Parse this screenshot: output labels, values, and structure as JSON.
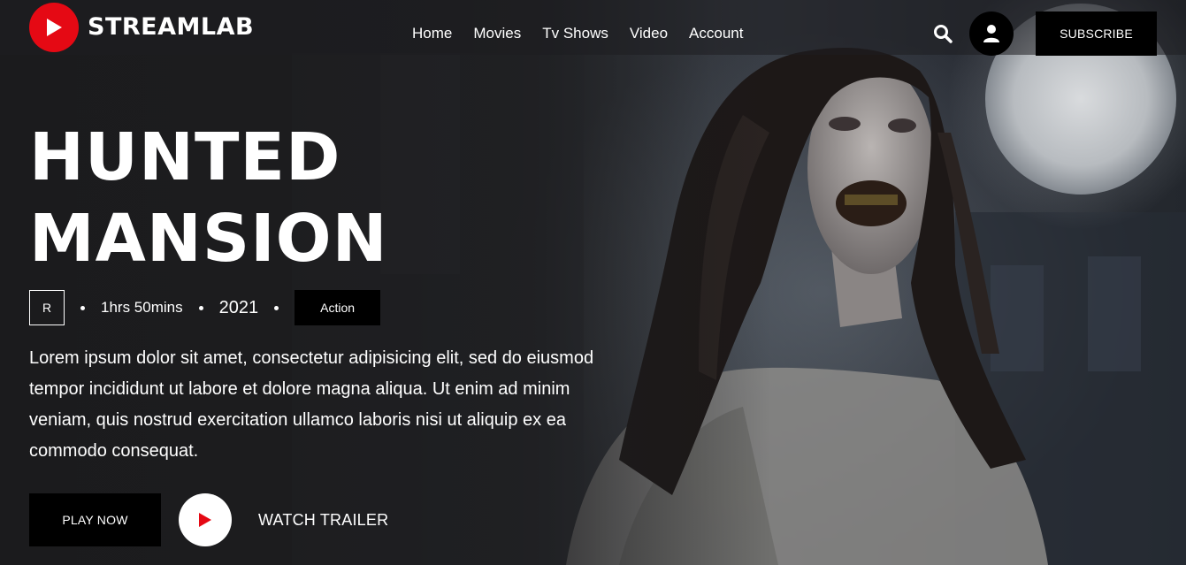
{
  "brand": {
    "name": "STREAMLAB",
    "accent_color": "#e50914",
    "logo_icon": "play-icon"
  },
  "nav": {
    "links": [
      {
        "label": "Home"
      },
      {
        "label": "Movies"
      },
      {
        "label": "Tv Shows"
      },
      {
        "label": "Video"
      },
      {
        "label": "Account"
      }
    ],
    "search_icon": "search-icon",
    "account_icon": "user-icon",
    "subscribe_label": "SUBSCRIBE"
  },
  "hero": {
    "title_line1": "HUNTED",
    "title_line2": "MANSION",
    "rating": "R",
    "duration": "1hrs 50mins",
    "year": "2021",
    "genre": "Action",
    "description": "Lorem ipsum dolor sit amet, consectetur adipisicing elit, sed do eiusmod tempor incididunt ut labore et dolore magna aliqua. Ut enim ad minim veniam, quis nostrud exercitation ullamco laboris nisi ut aliquip ex ea commodo consequat.",
    "play_label": "PLAY NOW",
    "trailer_label": "WATCH TRAILER",
    "trailer_icon": "play-icon"
  }
}
